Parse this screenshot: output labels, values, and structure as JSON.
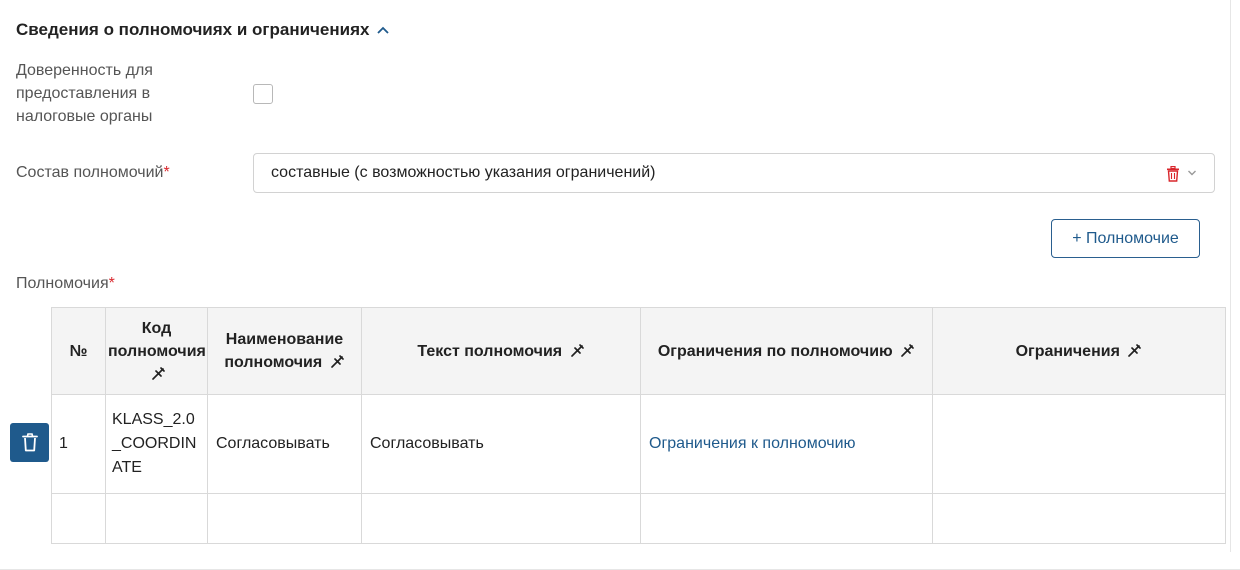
{
  "section": {
    "title": "Сведения о полномочиях и ограничениях",
    "collapse_icon": "chevron-up-icon"
  },
  "tax_authority": {
    "label_lines": [
      "Доверенность для",
      "предоставления в",
      "налоговые органы"
    ],
    "checked": false
  },
  "powers_composition": {
    "label": "Состав полномочий",
    "required_mark": "*",
    "value": "составные (с возможностью указания ограничений)",
    "clear_icon": "trash-icon",
    "dropdown_icon": "chevron-down-icon"
  },
  "add_power_button": {
    "label": "+ Полномочие"
  },
  "powers": {
    "label": "Полномочия",
    "required_mark": "*",
    "columns": {
      "number": "№",
      "code": "Код полномочия",
      "name": "Наименование полномочия",
      "text": "Текст полномочия",
      "limits_by_power": "Ограничения по полномочию",
      "limits": "Ограничения"
    },
    "rows": [
      {
        "number": "1",
        "code": "KLASS_2.0_COORDINATE",
        "name": "Согласовывать",
        "text": "Согласовывать",
        "limits_by_power": "Ограничения к полномочию",
        "limits": ""
      }
    ],
    "row_delete_icon": "trash-icon",
    "column_pin_icon": "pin-icon"
  },
  "colors": {
    "accent": "#1f5a8c",
    "required": "#d9262c",
    "delete_icon": "#d9262c"
  }
}
